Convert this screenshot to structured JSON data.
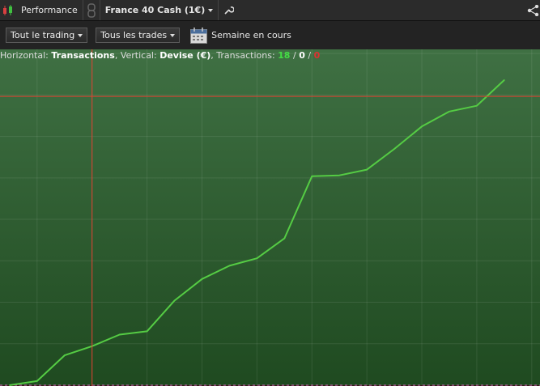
{
  "topbar": {
    "module_label": "Performance",
    "instrument_label": "France 40 Cash (1€)"
  },
  "toolbar": {
    "filter_trading": "Tout le trading",
    "filter_trades": "Tous les trades",
    "period_label": "Semaine en cours"
  },
  "info": {
    "horizontal_label": "Horizontal:",
    "horizontal_value": "Transactions",
    "vertical_label": "Vertical:",
    "vertical_value": "Devise (€)",
    "transactions_label": "Transactions:",
    "count_green": "18",
    "sep1": "/",
    "count_neutral": "0",
    "sep2": "/",
    "count_red": "0"
  },
  "colors": {
    "line": "#55cc44",
    "crosshair": "#e04030",
    "win": "#44dd44",
    "loss": "#e03030",
    "bg_top": "#3f7043",
    "bg_bottom": "#1f4a20"
  },
  "chart_data": {
    "type": "line",
    "title": "",
    "xlabel": "Transactions",
    "ylabel": "Devise (€)",
    "x": [
      0,
      1,
      2,
      3,
      4,
      5,
      6,
      7,
      8,
      9,
      10,
      11,
      12,
      13,
      14,
      15,
      16,
      17,
      18
    ],
    "series": [
      {
        "values": [
          0,
          5,
          36,
          47,
          61,
          65,
          102,
          128,
          144,
          153,
          177,
          252,
          253,
          260,
          285,
          312,
          330,
          337,
          368
        ]
      }
    ],
    "xlim": [
      -0.35,
      19.3
    ],
    "ylim": [
      -1,
      405
    ],
    "grid": true
  }
}
